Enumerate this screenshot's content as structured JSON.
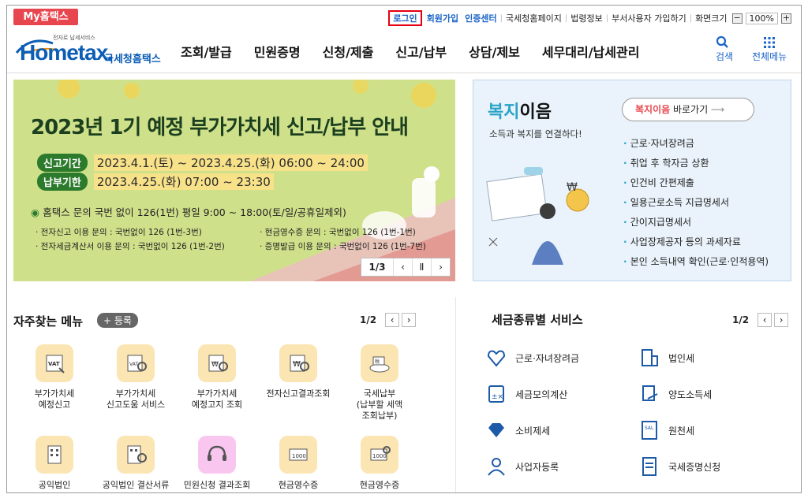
{
  "utility": {
    "myhome": "My홈택스",
    "links": [
      "로그인",
      "회원가입",
      "인증센터",
      "국세청홈페이지",
      "법령정보",
      "부서사용자 가입하기",
      "화면크기"
    ],
    "zoom": "100%"
  },
  "logo": {
    "sub": "전자로 납세서비스",
    "word": "Hometax.",
    "kr": "국세청홈택스"
  },
  "menu": [
    "조회/발급",
    "민원증명",
    "신청/제출",
    "신고/납부",
    "상담/제보",
    "세무대리/납세관리"
  ],
  "gnb_icons": {
    "search": "검색",
    "all": "전체메뉴"
  },
  "banner": {
    "title": "2023년 1기 예정 부가가치세 신고/납부 안내",
    "period_label": "신고기간",
    "period_value": "2023.4.1.(토) ~ 2023.4.25.(화) 06:00 ~ 24:00",
    "due_label": "납부기한",
    "due_value": "2023.4.25.(화) 07:00 ~ 23:30",
    "info": "홈택스 문의 국번 없이 126(1번) 평일 9:00 ~ 18:00(토/일/공휴일제외)",
    "d1": "· 전자신고 이용 문의 : 국번없이 126 (1번-3번)",
    "d2": "· 현금영수증 문의 : 국번없이 126 (1번-1번)",
    "d3": "· 전자세금계산서 이용 문의 : 국번없이 126 (1번-2번)",
    "d4": "· 증명발급 이용 문의 : 국번없이 126 (1번-7번)",
    "pager": "1/3"
  },
  "welfare": {
    "title_hl": "복지",
    "title_rest": "이음",
    "sub": "소득과 복지를 연결하다!",
    "go_hl": "복지이음",
    "go_rest": " 바로가기",
    "items": [
      "근로·자녀장려금",
      "취업 후 학자금 상환",
      "인건비 간편제출",
      "일용근로소득 지급명세서",
      "간이지급명세서",
      "사업장제공자 등의 과세자료",
      "본인 소득내역 확인(근로·인적용역)"
    ]
  },
  "frequent": {
    "title": "자주찾는 메뉴",
    "register": "+ 등록",
    "page": "1/2",
    "items": [
      {
        "label": "부가가치세\n예정신고",
        "icon": "vat-icon"
      },
      {
        "label": "부가가치세\n신고도움 서비스",
        "icon": "vat-search-icon"
      },
      {
        "label": "부가가치세\n예정고지 조회",
        "icon": "won-doc-search-icon"
      },
      {
        "label": "전자신고결과조회",
        "icon": "won-search-icon"
      },
      {
        "label": "국세납부\n(납부할 세액\n조회납부)",
        "icon": "tax-payment-icon"
      },
      {
        "label": "공익법인",
        "icon": "building-icon"
      },
      {
        "label": "공익법인 결산서류",
        "icon": "building-search-icon"
      },
      {
        "label": "민원신청 결과조회",
        "icon": "headset-icon"
      },
      {
        "label": "현금영수증",
        "icon": "cash-receipt-icon"
      },
      {
        "label": "현금영수증",
        "icon": "cash-receipt-search-icon"
      }
    ]
  },
  "taxtype": {
    "title": "세금종류별 서비스",
    "page": "1/2",
    "items": [
      "근로·자녀장려금",
      "법인세",
      "세금모의계산",
      "양도소득세",
      "소비제세",
      "원천세",
      "사업자등록",
      "국세증명신청"
    ]
  }
}
